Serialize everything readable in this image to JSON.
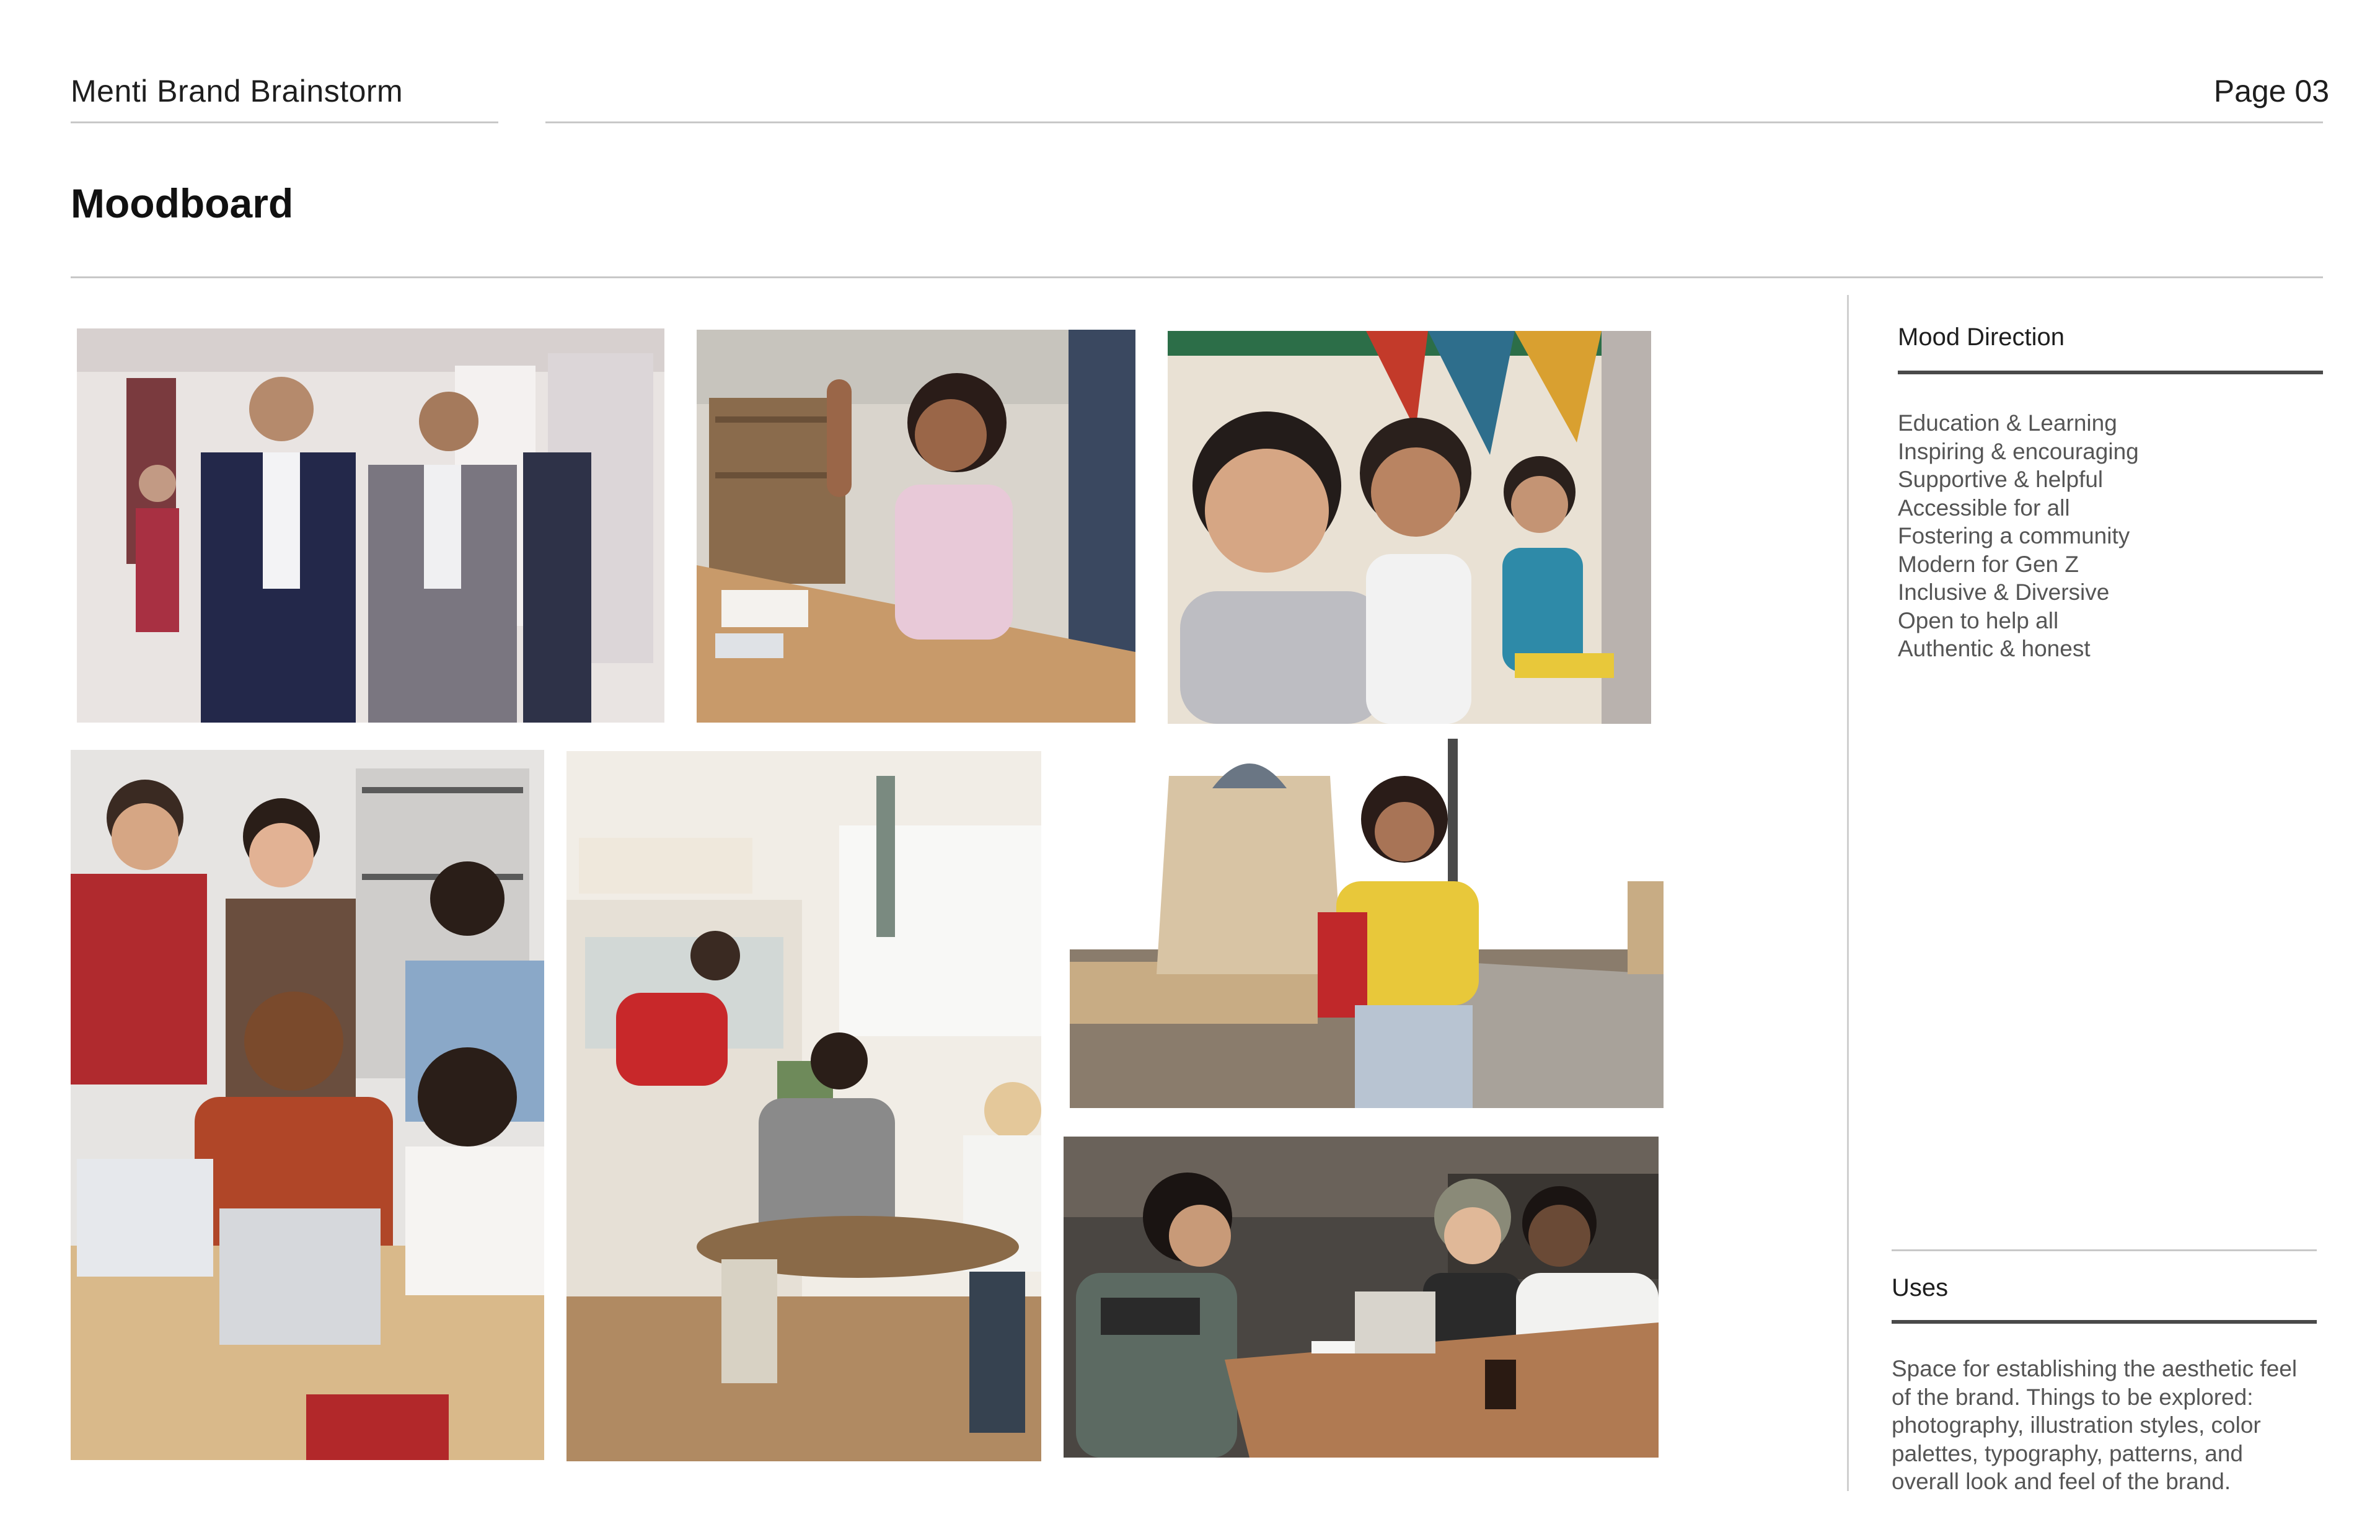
{
  "header": {
    "doc_title": "Menti Brand Brainstorm",
    "page_label": "Page 03"
  },
  "section": {
    "title": "Moodboard"
  },
  "moodboard": {
    "photos": [
      {
        "id": "students-hallway",
        "palette": [
          "#e9e4e2",
          "#23284a",
          "#7a7680",
          "#a83042"
        ]
      },
      {
        "id": "girl-raising-hand",
        "palette": [
          "#d9d4cc",
          "#c89a6a",
          "#e8c9d8",
          "#2a1c18"
        ]
      },
      {
        "id": "classroom-smiling",
        "palette": [
          "#c33a2a",
          "#e9e1d4",
          "#2e6e8c",
          "#b9b2ae"
        ]
      },
      {
        "id": "group-laptops",
        "palette": [
          "#e6e4e2",
          "#b04628",
          "#d9b98a",
          "#8aa8c8"
        ]
      },
      {
        "id": "cafe-study-group",
        "palette": [
          "#f1ede6",
          "#c8282a",
          "#8a6a48",
          "#6e7c70"
        ]
      },
      {
        "id": "student-with-books",
        "palette": [
          "#f2f2f2",
          "#e8c83a",
          "#c0282a",
          "#9a8c7a"
        ]
      },
      {
        "id": "students-notebook-laptop",
        "palette": [
          "#4a4642",
          "#b07a52",
          "#d8d4cc",
          "#5c6a62"
        ]
      }
    ]
  },
  "sidebar": {
    "mood_direction": {
      "heading": "Mood Direction",
      "items": [
        "Education & Learning",
        "Inspiring & encouraging",
        "Supportive & helpful",
        "Accessible for all",
        "Fostering a community",
        "Modern for Gen Z",
        "Inclusive & Diversive",
        "Open to help all",
        "Authentic & honest"
      ]
    },
    "uses": {
      "heading": "Uses",
      "text_lines": [
        "Space for establishing the aesthetic feel",
        "of the brand. Things to be explored:",
        "photography, illustration styles, color",
        "palettes, typography, patterns, and",
        "overall look and feel of the brand."
      ]
    }
  }
}
